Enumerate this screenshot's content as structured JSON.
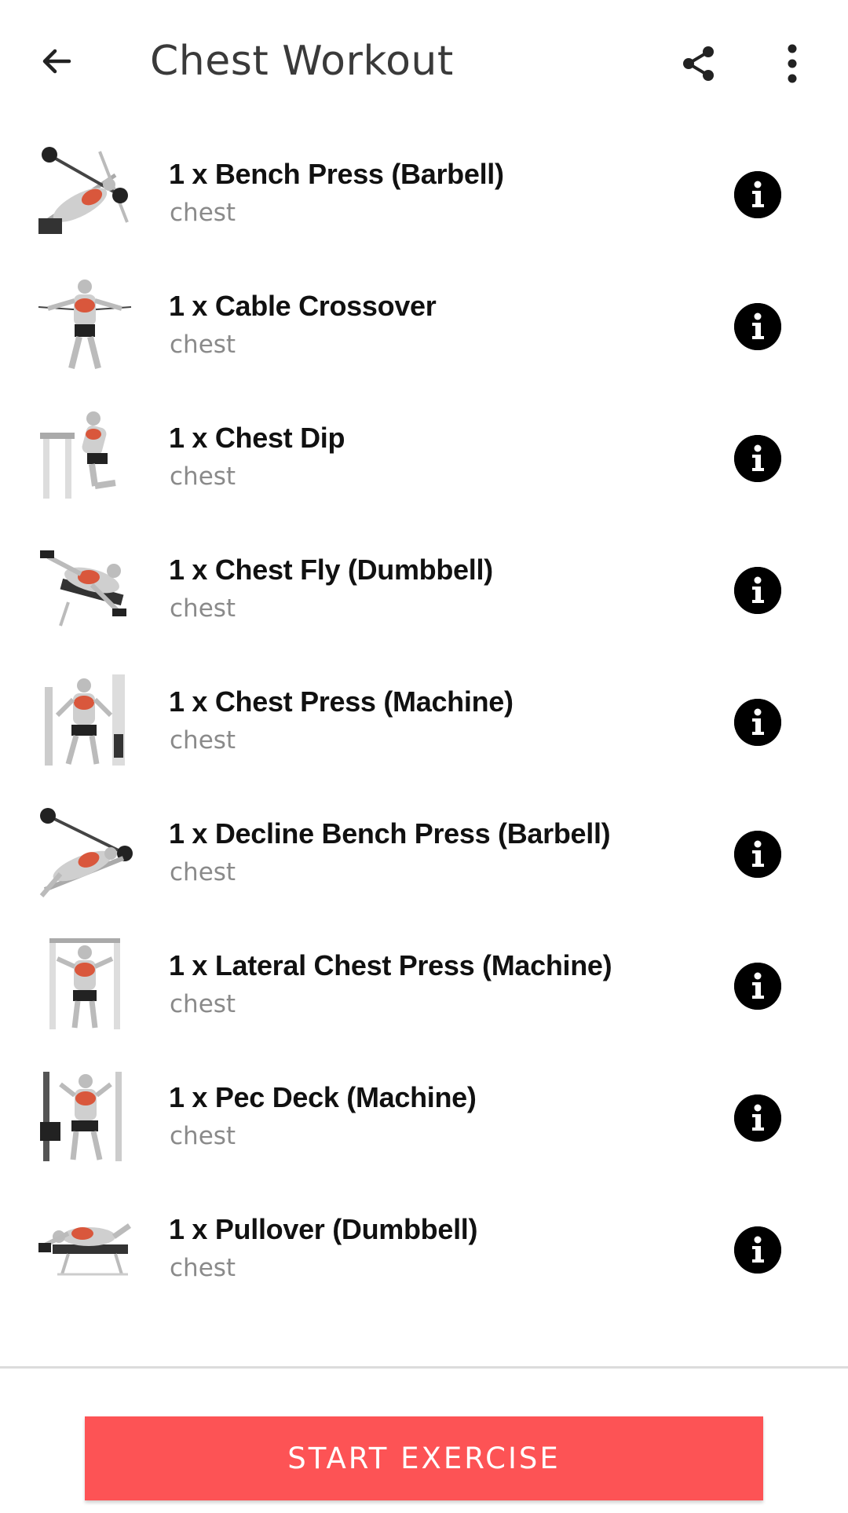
{
  "header": {
    "title": "Chest Workout",
    "back_icon": "arrow-left-icon",
    "share_icon": "share-icon",
    "more_icon": "more-vert-icon"
  },
  "exercises": [
    {
      "name": "1 x Bench Press (Barbell)",
      "muscle": "chest",
      "thumb": "bench-press-illustration"
    },
    {
      "name": "1 x Cable Crossover",
      "muscle": "chest",
      "thumb": "cable-crossover-illustration"
    },
    {
      "name": "1 x Chest Dip",
      "muscle": "chest",
      "thumb": "chest-dip-illustration"
    },
    {
      "name": "1 x Chest Fly (Dumbbell)",
      "muscle": "chest",
      "thumb": "chest-fly-illustration"
    },
    {
      "name": "1 x Chest Press (Machine)",
      "muscle": "chest",
      "thumb": "chest-press-machine-illustration"
    },
    {
      "name": "1 x Decline Bench Press (Barbell)",
      "muscle": "chest",
      "thumb": "decline-bench-illustration"
    },
    {
      "name": "1 x Lateral Chest Press (Machine)",
      "muscle": "chest",
      "thumb": "lateral-chest-press-illustration"
    },
    {
      "name": "1 x Pec Deck (Machine)",
      "muscle": "chest",
      "thumb": "pec-deck-illustration"
    },
    {
      "name": "1 x Pullover (Dumbbell)",
      "muscle": "chest",
      "thumb": "pullover-illustration"
    }
  ],
  "footer": {
    "start_label": "START EXERCISE"
  },
  "colors": {
    "accent": "#fd5355",
    "muscle_highlight": "#d9573c",
    "info_bg": "#000000",
    "subtitle": "#8a8a8a"
  }
}
